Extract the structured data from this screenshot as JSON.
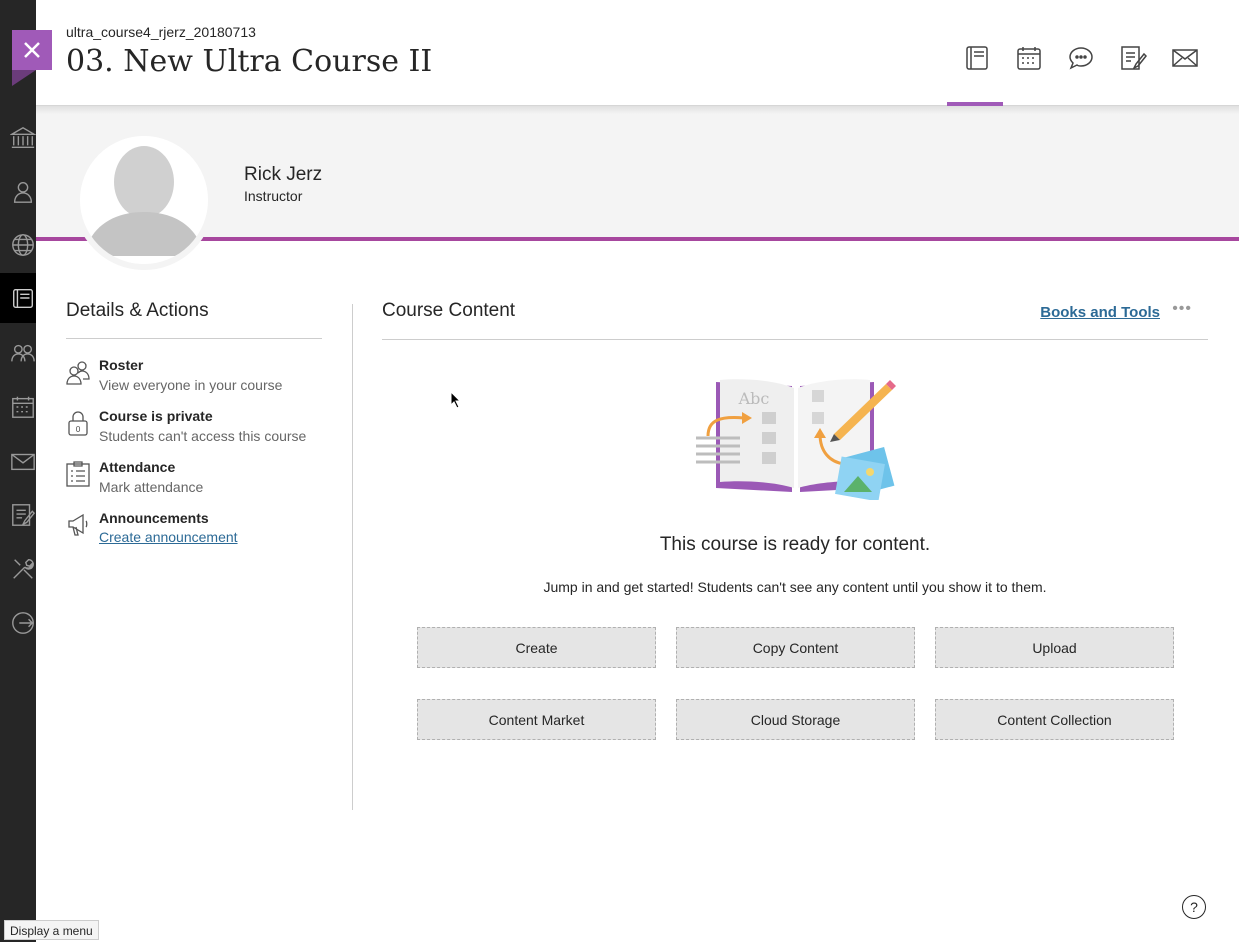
{
  "header": {
    "course_id": "ultra_course4_rjerz_20180713",
    "course_title": "03. New Ultra Course II",
    "icons": [
      "course-content-icon",
      "calendar-icon",
      "discussions-icon",
      "gradebook-icon",
      "messages-icon"
    ]
  },
  "left_rail": {
    "icons": [
      "institution-icon",
      "profile-icon",
      "globe-icon",
      "courses-icon",
      "organizations-icon",
      "calendar-icon",
      "messages-icon",
      "grades-icon",
      "tools-icon",
      "sign-out-icon"
    ]
  },
  "instructor": {
    "name": "Rick Jerz",
    "role": "Instructor"
  },
  "details": {
    "title": "Details & Actions",
    "items": [
      {
        "title": "Roster",
        "subtitle": "View everyone in your course",
        "icon": "roster-icon"
      },
      {
        "title": "Course is private",
        "subtitle": "Students can't access this course",
        "icon": "lock-icon"
      },
      {
        "title": "Attendance",
        "subtitle": "Mark attendance",
        "icon": "attendance-icon"
      },
      {
        "title": "Announcements",
        "link": "Create announcement",
        "icon": "megaphone-icon"
      }
    ]
  },
  "content": {
    "title": "Course Content",
    "books_link": "Books and Tools",
    "more": "•••",
    "illustration_text": "Abc",
    "ready_title": "This course is ready for content.",
    "ready_subtitle": "Jump in and get started! Students can't see any content until you show it to them.",
    "buttons": [
      "Create",
      "Copy Content",
      "Upload",
      "Content Market",
      "Cloud Storage",
      "Content Collection"
    ]
  },
  "help": "?",
  "status_tip": "Display a menu",
  "colors": {
    "accent": "#a05ab8",
    "banner_line": "#a7479e",
    "rail": "#262626",
    "link": "#2c6a96"
  }
}
